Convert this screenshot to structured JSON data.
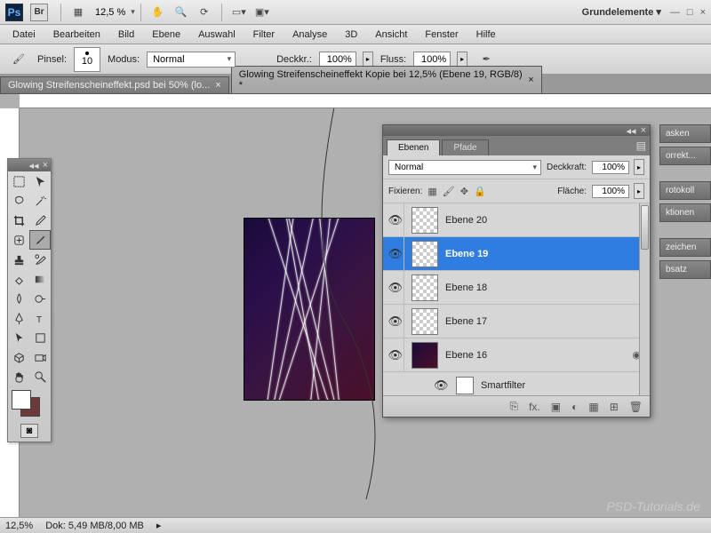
{
  "app": {
    "ps": "Ps",
    "br": "Br",
    "zoom": "12,5 %",
    "workspace": "Grundelemente ▾"
  },
  "menu": [
    "Datei",
    "Bearbeiten",
    "Bild",
    "Ebene",
    "Auswahl",
    "Filter",
    "Analyse",
    "3D",
    "Ansicht",
    "Fenster",
    "Hilfe"
  ],
  "options": {
    "brush_label": "Pinsel:",
    "brush_size": "10",
    "mode_label": "Modus:",
    "mode_value": "Normal",
    "opacity_label": "Deckkr.:",
    "opacity_value": "100%",
    "flow_label": "Fluss:",
    "flow_value": "100%"
  },
  "tabs": [
    {
      "title": "Glowing Streifenscheineffekt.psd bei 50% (lo...",
      "close": "×"
    },
    {
      "title": "Glowing Streifenscheineffekt Kopie bei 12,5% (Ebene 19, RGB/8) *",
      "close": "×"
    }
  ],
  "status": {
    "zoom": "12,5%",
    "doc": "Dok: 5,49 MB/8,00 MB"
  },
  "right_tabs": [
    "asken",
    "orrekt...",
    "rotokoll",
    "ktionen",
    "zeichen",
    "bsatz"
  ],
  "layers_panel": {
    "tab_layers": "Ebenen",
    "tab_paths": "Pfade",
    "blend": "Normal",
    "opacity_label": "Deckkraft:",
    "opacity": "100%",
    "lock_label": "Fixieren:",
    "fill_label": "Fläche:",
    "fill": "100%",
    "smartfilter": "Smartfilter",
    "layers": [
      {
        "name": "Ebene 20",
        "sel": false,
        "purple": false
      },
      {
        "name": "Ebene 19",
        "sel": true,
        "purple": false
      },
      {
        "name": "Ebene 18",
        "sel": false,
        "purple": false
      },
      {
        "name": "Ebene 17",
        "sel": false,
        "purple": false
      },
      {
        "name": "Ebene 16",
        "sel": false,
        "purple": true,
        "sf": true
      }
    ],
    "bottom_icons": [
      "⎘",
      "fx.",
      "▣",
      "◐",
      "▦",
      "⊞",
      "🗑"
    ]
  },
  "watermark": "PSD-Tutorials.de"
}
